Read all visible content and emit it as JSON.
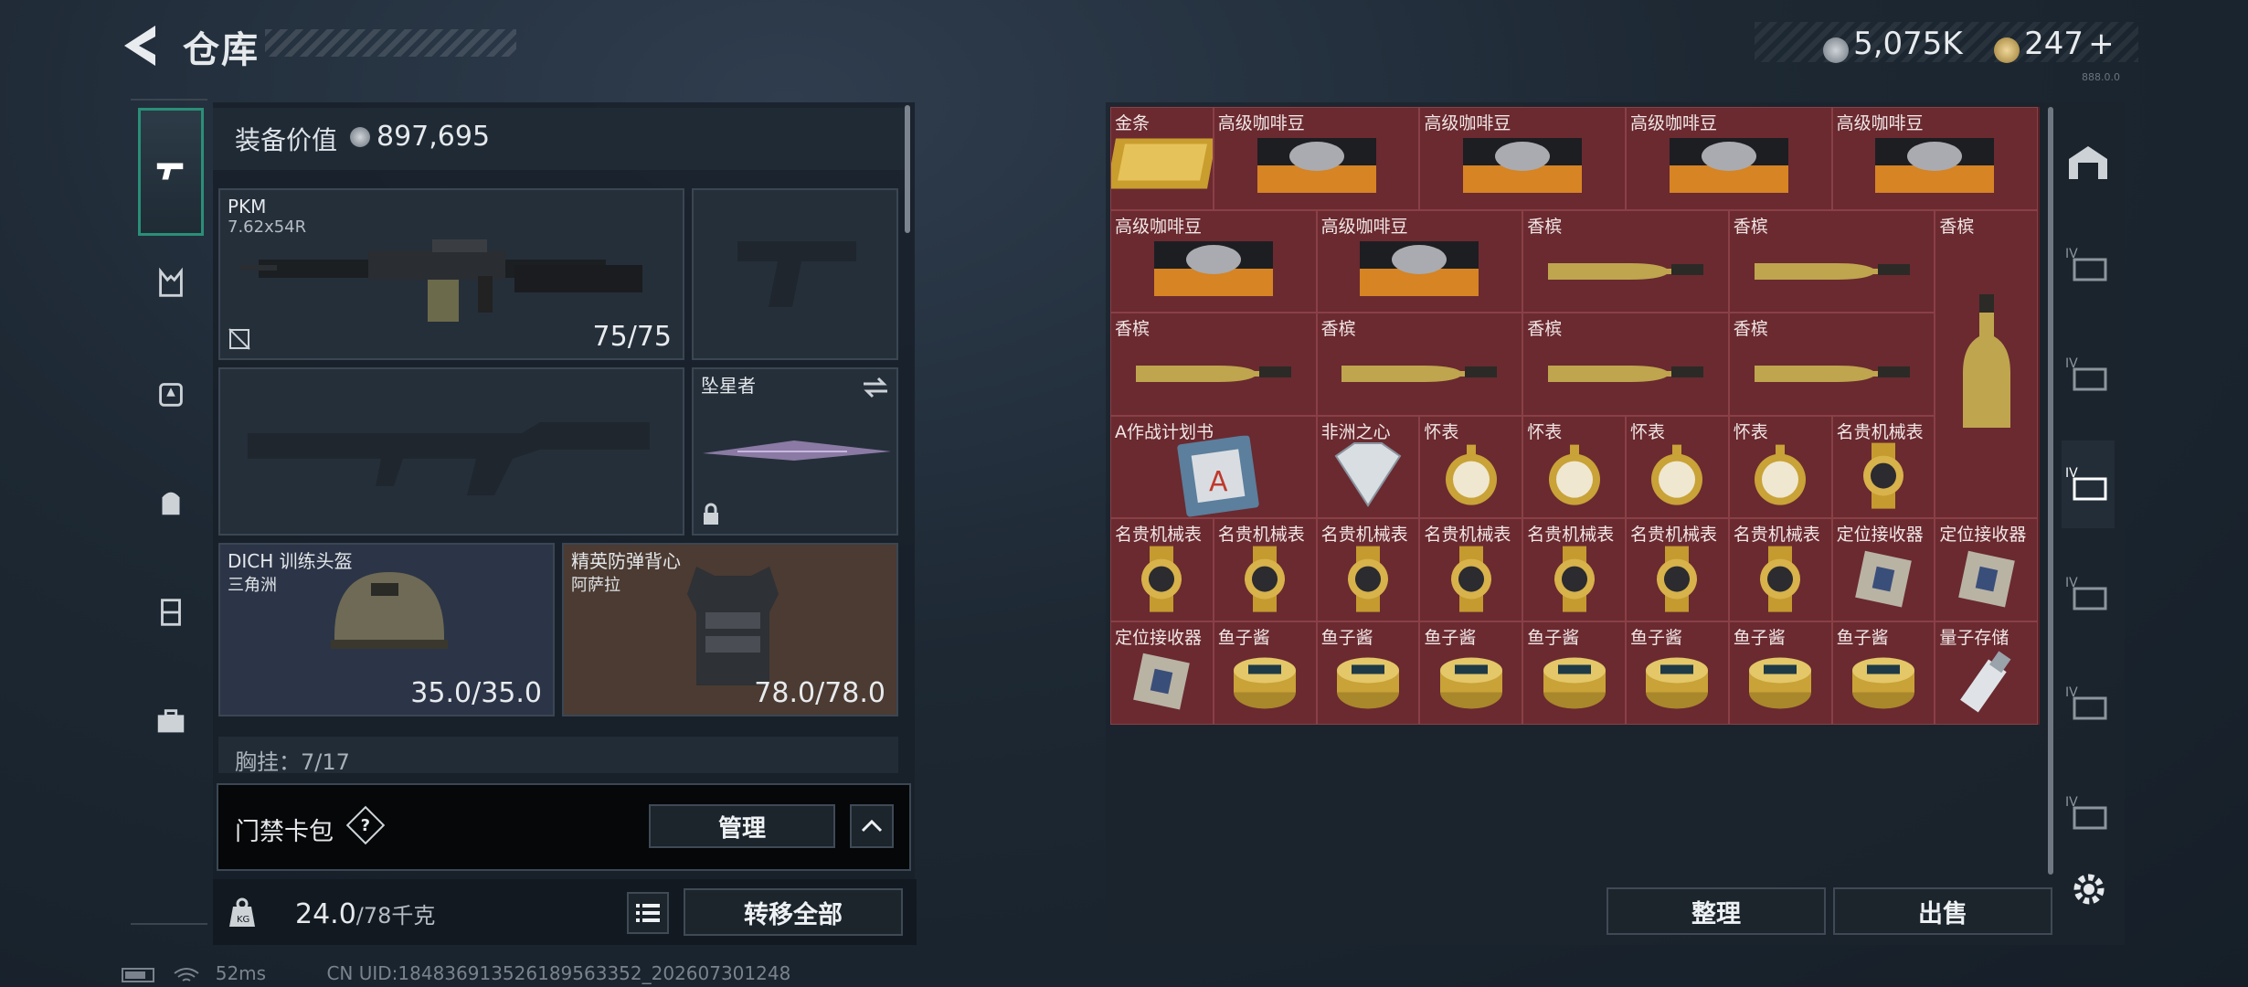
{
  "header": {
    "title": "仓库",
    "currency_main": "5,075K",
    "currency_secondary": "247",
    "plus": "+"
  },
  "left_nav": {
    "items": [
      "weapon-tab",
      "vest-tab",
      "helmet-tab",
      "backpack-tab",
      "rig-tab",
      "case-tab"
    ]
  },
  "loadout": {
    "equipment_value_label": "装备价值",
    "equipment_value": "897,695",
    "primary": {
      "name": "PKM",
      "ammo": "7.62x54R",
      "durability": "75/75"
    },
    "melee": {
      "name": "坠星者"
    },
    "helmet": {
      "name": "DICH 训练头盔",
      "sub": "三角洲",
      "durability": "35.0/35.0"
    },
    "armor": {
      "name": "精英防弹背心",
      "sub": "阿萨拉",
      "durability": "78.0/78.0"
    },
    "chest_rig_partial": "胸挂：7/17",
    "keycard_label": "门禁卡包",
    "manage_button": "管理",
    "weight_value": "24.0",
    "weight_max": "/78千克",
    "transfer_all_button": "转移全部"
  },
  "inventory": {
    "items": [
      {
        "label": "金条"
      },
      {
        "label": "高级咖啡豆"
      },
      {
        "label": "高级咖啡豆"
      },
      {
        "label": "高级咖啡豆"
      },
      {
        "label": "高级咖啡豆"
      },
      {
        "label": "高级咖啡豆"
      },
      {
        "label": "高级咖啡豆"
      },
      {
        "label": "香槟"
      },
      {
        "label": "香槟"
      },
      {
        "label": "香槟"
      },
      {
        "label": "香槟"
      },
      {
        "label": "香槟"
      },
      {
        "label": "香槟"
      },
      {
        "label": "香槟"
      },
      {
        "label": "A作战计划书"
      },
      {
        "label": "非洲之心"
      },
      {
        "label": "怀表"
      },
      {
        "label": "怀表"
      },
      {
        "label": "怀表"
      },
      {
        "label": "怀表"
      },
      {
        "label": "名贵机械表"
      },
      {
        "label": "名贵机械表"
      },
      {
        "label": "名贵机械表"
      },
      {
        "label": "名贵机械表"
      },
      {
        "label": "名贵机械表"
      },
      {
        "label": "名贵机械表"
      },
      {
        "label": "名贵机械表"
      },
      {
        "label": "名贵机械表"
      },
      {
        "label": "定位接收器"
      },
      {
        "label": "定位接收器"
      },
      {
        "label": "定位接收器"
      },
      {
        "label": "鱼子酱"
      },
      {
        "label": "鱼子酱"
      },
      {
        "label": "鱼子酱"
      },
      {
        "label": "鱼子酱"
      },
      {
        "label": "鱼子酱"
      },
      {
        "label": "鱼子酱"
      },
      {
        "label": "鱼子酱"
      },
      {
        "label": "量子存储"
      }
    ],
    "sort_button": "整理",
    "sell_button": "出售"
  },
  "right_nav": {
    "labels": [
      "IV",
      "IV",
      "IV",
      "IV",
      "IV",
      "IV"
    ]
  },
  "status_bar": {
    "ping": "52ms",
    "uid": "CN UID:18483691352618956335​2_202607301248"
  },
  "version": "888.0.0",
  "colors": {
    "accent": "#2a8f78",
    "inventory_cell": "#6a2a30"
  }
}
